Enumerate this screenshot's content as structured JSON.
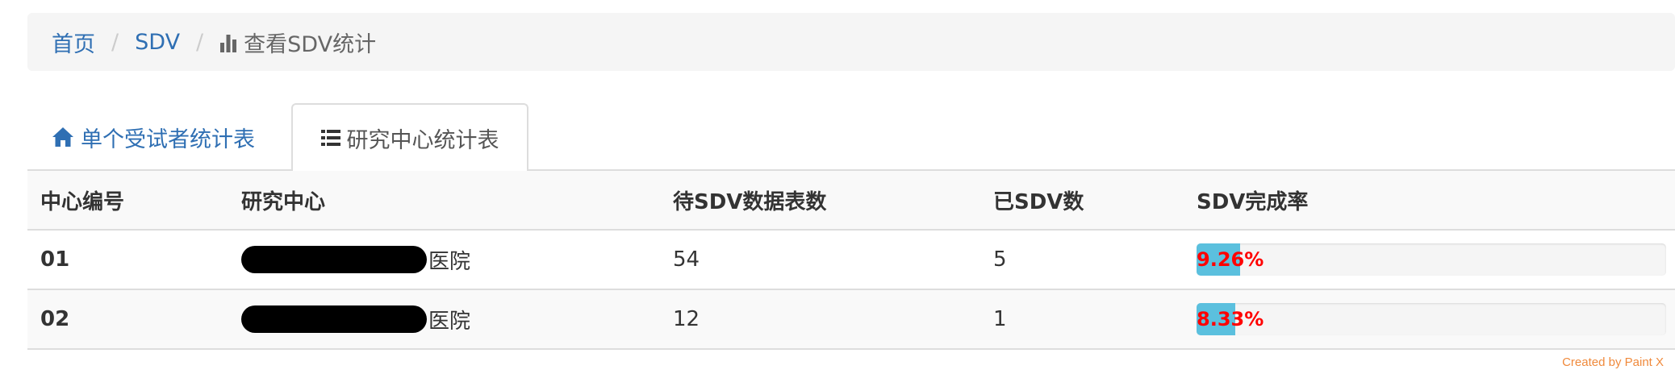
{
  "breadcrumb": {
    "home": "首页",
    "sdv": "SDV",
    "current": "查看SDV统计",
    "current_icon": "bar-chart-icon"
  },
  "tabs": [
    {
      "label": "单个受试者统计表",
      "icon": "home-icon",
      "active": false
    },
    {
      "label": "研究中心统计表",
      "icon": "list-icon",
      "active": true
    }
  ],
  "table": {
    "headers": [
      "中心编号",
      "研究中心",
      "待SDV数据表数",
      "已SDV数",
      "SDV完成率"
    ],
    "rows": [
      {
        "center_no": "01",
        "center_name": "医院",
        "pending": "54",
        "done": "5",
        "rate_label": "9.26%",
        "rate": 9.26
      },
      {
        "center_no": "02",
        "center_name": "医院",
        "pending": "12",
        "done": "1",
        "rate_label": "8.33%",
        "rate": 8.33
      }
    ]
  },
  "colors": {
    "link": "#2f6fb3",
    "progress_fill": "#5bc0de",
    "progress_text": "#ff0000"
  },
  "watermark": "Created by Paint X"
}
